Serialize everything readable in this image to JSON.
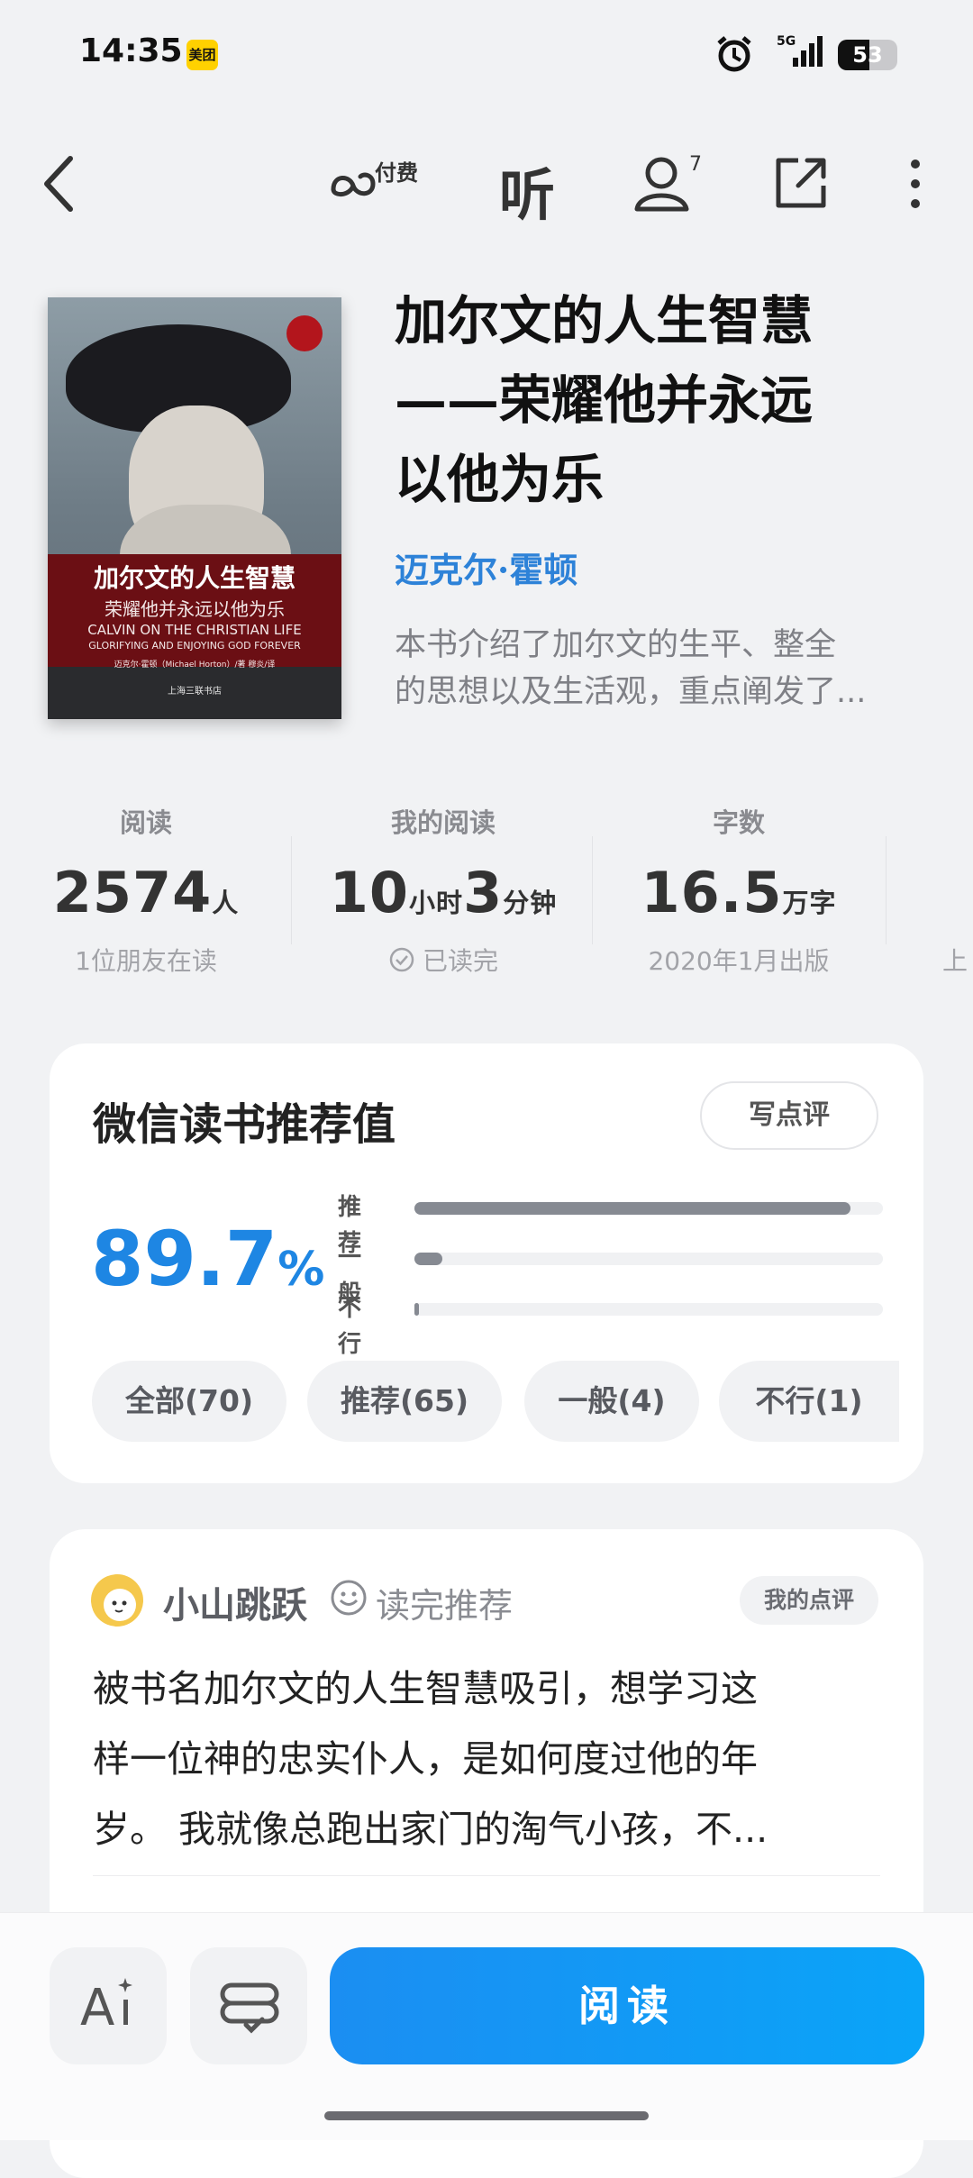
{
  "status_bar": {
    "time": "14:35",
    "app_badge": "美团",
    "network": "5G",
    "battery_level": "53",
    "battery_fraction": 0.53
  },
  "top_bar": {
    "paid_label": "付费",
    "listen_label": "听",
    "followers_count": "7",
    "icons": [
      "back-icon",
      "infinity-icon",
      "listen-icon",
      "person-icon",
      "share-icon",
      "more-icon"
    ]
  },
  "book": {
    "title_lines": [
      "加尔文的人生智慧",
      "——荣耀他并永远",
      "以他为乐"
    ],
    "author": "迈克尔·霍顿",
    "intro_lines": [
      "本书介绍了加尔文的生平、整全",
      "的思想以及生活观，重点阐发了..."
    ],
    "cover": {
      "title": "加尔文的人生智慧",
      "subtitle": "荣耀他并永远以他为乐",
      "english_title": "CALVIN ON THE CHRISTIAN LIFE",
      "english_subtitle": "GLORIFYING AND ENJOYING GOD FOREVER",
      "authors": "迈克尔·霍顿（Michael Horton）/著   穆炎/译",
      "publisher": "上海三联书店"
    }
  },
  "stats": [
    {
      "label": "阅读",
      "value": "2574",
      "unit": "人",
      "sub": "1位朋友在读"
    },
    {
      "label": "我的阅读",
      "value_a": "10",
      "unit_a": "小时",
      "value_b": "3",
      "unit_b": "分钟",
      "sub": "已读完"
    },
    {
      "label": "字数",
      "value": "16.5",
      "unit": "万字",
      "sub": "2020年1月出版"
    },
    {
      "label": "",
      "sub": "上"
    }
  ],
  "rating": {
    "title": "微信读书推荐值",
    "write_review": "写点评",
    "value": "89.7",
    "percent_sign": "%",
    "bars": [
      {
        "label": "推荐",
        "fraction": 0.93
      },
      {
        "label": "一般",
        "fraction": 0.06
      },
      {
        "label": "不行",
        "fraction": 0.01
      }
    ],
    "filters": [
      "全部(70)",
      "推荐(65)",
      "一般(4)",
      "不行(1)"
    ]
  },
  "review": {
    "reviewer": "小山跳跃",
    "tag": "读完推荐",
    "badge": "我的点评",
    "text_lines": [
      "被书名加尔文的人生智慧吸引，想学习这",
      "样一位神的忠实仆人，是如何度过他的年",
      "岁。 我就像总跑出家门的淘气小孩，不..."
    ]
  },
  "bottom_bar": {
    "font_icon_text": "A",
    "read_label": "阅读"
  },
  "colors": {
    "accent_blue": "#1e86e3",
    "author_blue": "#2d82d8",
    "read_button": "#1b8ef2",
    "bar_fill": "#868a92",
    "background": "#f1f2f4"
  }
}
